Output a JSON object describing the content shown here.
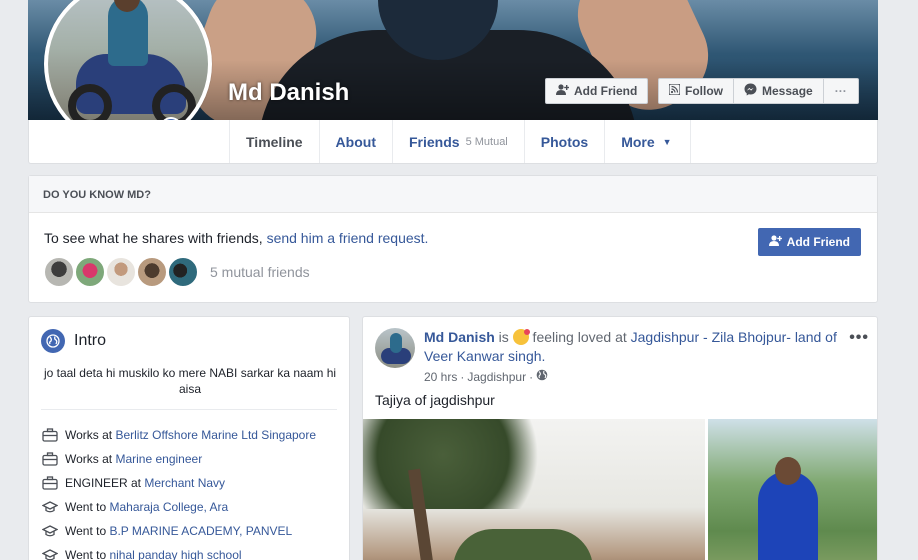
{
  "profile": {
    "name": "Md Danish"
  },
  "cover_buttons": {
    "add_friend": "Add Friend",
    "follow": "Follow",
    "message": "Message",
    "more": "···"
  },
  "nav": {
    "tabs": [
      {
        "label": "Timeline",
        "sub": ""
      },
      {
        "label": "About",
        "sub": ""
      },
      {
        "label": "Friends",
        "sub": "5 Mutual"
      },
      {
        "label": "Photos",
        "sub": ""
      },
      {
        "label": "More",
        "sub": ""
      }
    ]
  },
  "know": {
    "heading": "DO YOU KNOW MD?",
    "text_prefix": "To see what he shares with friends, ",
    "link": "send him a friend request.",
    "button": "Add Friend",
    "mutual_text": "5 mutual friends"
  },
  "intro": {
    "title": "Intro",
    "bio": "jo taal deta hi muskilo ko mere NABI sarkar ka naam hi aisa",
    "facts": [
      {
        "icon": "briefcase-icon",
        "prefix": "Works at ",
        "link": "Berlitz Offshore Marine Ltd Singapore"
      },
      {
        "icon": "briefcase-icon",
        "prefix": "Works at ",
        "link": "Marine engineer"
      },
      {
        "icon": "briefcase-icon",
        "prefix": "ENGINEER at ",
        "link": "Merchant Navy"
      },
      {
        "icon": "graduation-cap-icon",
        "prefix": "Went to ",
        "link": "Maharaja College, Ara"
      },
      {
        "icon": "graduation-cap-icon",
        "prefix": "Went to ",
        "link": "B.P MARINE ACADEMY, PANVEL"
      },
      {
        "icon": "graduation-cap-icon",
        "prefix": "Went to ",
        "link": "nihal panday high school"
      }
    ]
  },
  "post": {
    "author": "Md Danish",
    "is": " is ",
    "feeling": " feeling loved at ",
    "place": "Jagdishpur - Zila Bhojpur- land of Veer Kanwar singh.",
    "time": "20 hrs",
    "sep": " · ",
    "location": "Jagdishpur",
    "sep2": " · ",
    "text": "Tajiya of jagdishpur",
    "more": "•••"
  },
  "colors": {
    "brand": "#4267b2",
    "link": "#365899",
    "background": "#e9ebee"
  }
}
